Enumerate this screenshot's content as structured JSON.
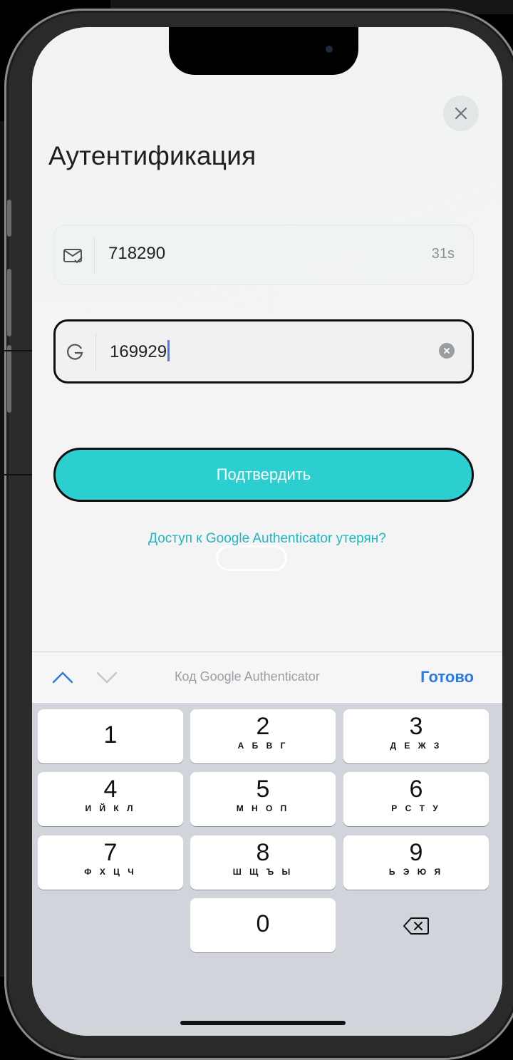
{
  "screen": {
    "title": "Аутентификация",
    "close_icon": "close-icon"
  },
  "email_field": {
    "icon": "mail-check-icon",
    "value": "718290",
    "timer": "31s"
  },
  "ga_field": {
    "icon": "google-icon",
    "value": "169929",
    "clear_icon": "clear-icon"
  },
  "confirm_button": {
    "label": "Подтвердить"
  },
  "lost_link": {
    "label": "Доступ к Google Authenticator утерян?"
  },
  "keyboard_bar": {
    "hint": "Код Google Authenticator",
    "done_label": "Готово"
  },
  "keys": [
    {
      "num": "1",
      "letters": ""
    },
    {
      "num": "2",
      "letters": "А Б В Г"
    },
    {
      "num": "3",
      "letters": "Д Е Ж З"
    },
    {
      "num": "4",
      "letters": "И Й К Л"
    },
    {
      "num": "5",
      "letters": "М Н О П"
    },
    {
      "num": "6",
      "letters": "Р С Т У"
    },
    {
      "num": "7",
      "letters": "Ф Х Ц Ч"
    },
    {
      "num": "8",
      "letters": "Ш Щ Ъ Ы"
    },
    {
      "num": "9",
      "letters": "Ь Э Ю Я"
    },
    {
      "num": "0",
      "letters": ""
    }
  ],
  "colors": {
    "accent": "#2ccfcf",
    "link": "#1fb7c4",
    "done": "#2b7ae3"
  }
}
